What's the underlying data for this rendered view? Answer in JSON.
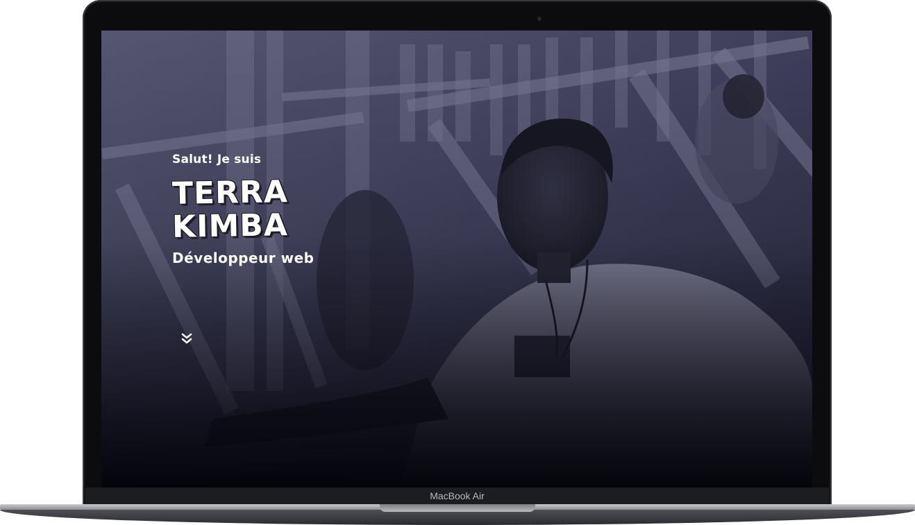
{
  "device": {
    "label": "MacBook Air"
  },
  "hero": {
    "greeting": "Salut! Je suis",
    "name_first": "TERRA",
    "name_last": "KIMBA",
    "role": "Développeur web",
    "scroll_icon": "double-chevron-down-icon"
  },
  "colors": {
    "text": "#ffffff",
    "overlay": "#1a1a2e",
    "bezel": "#0c0c0e"
  }
}
